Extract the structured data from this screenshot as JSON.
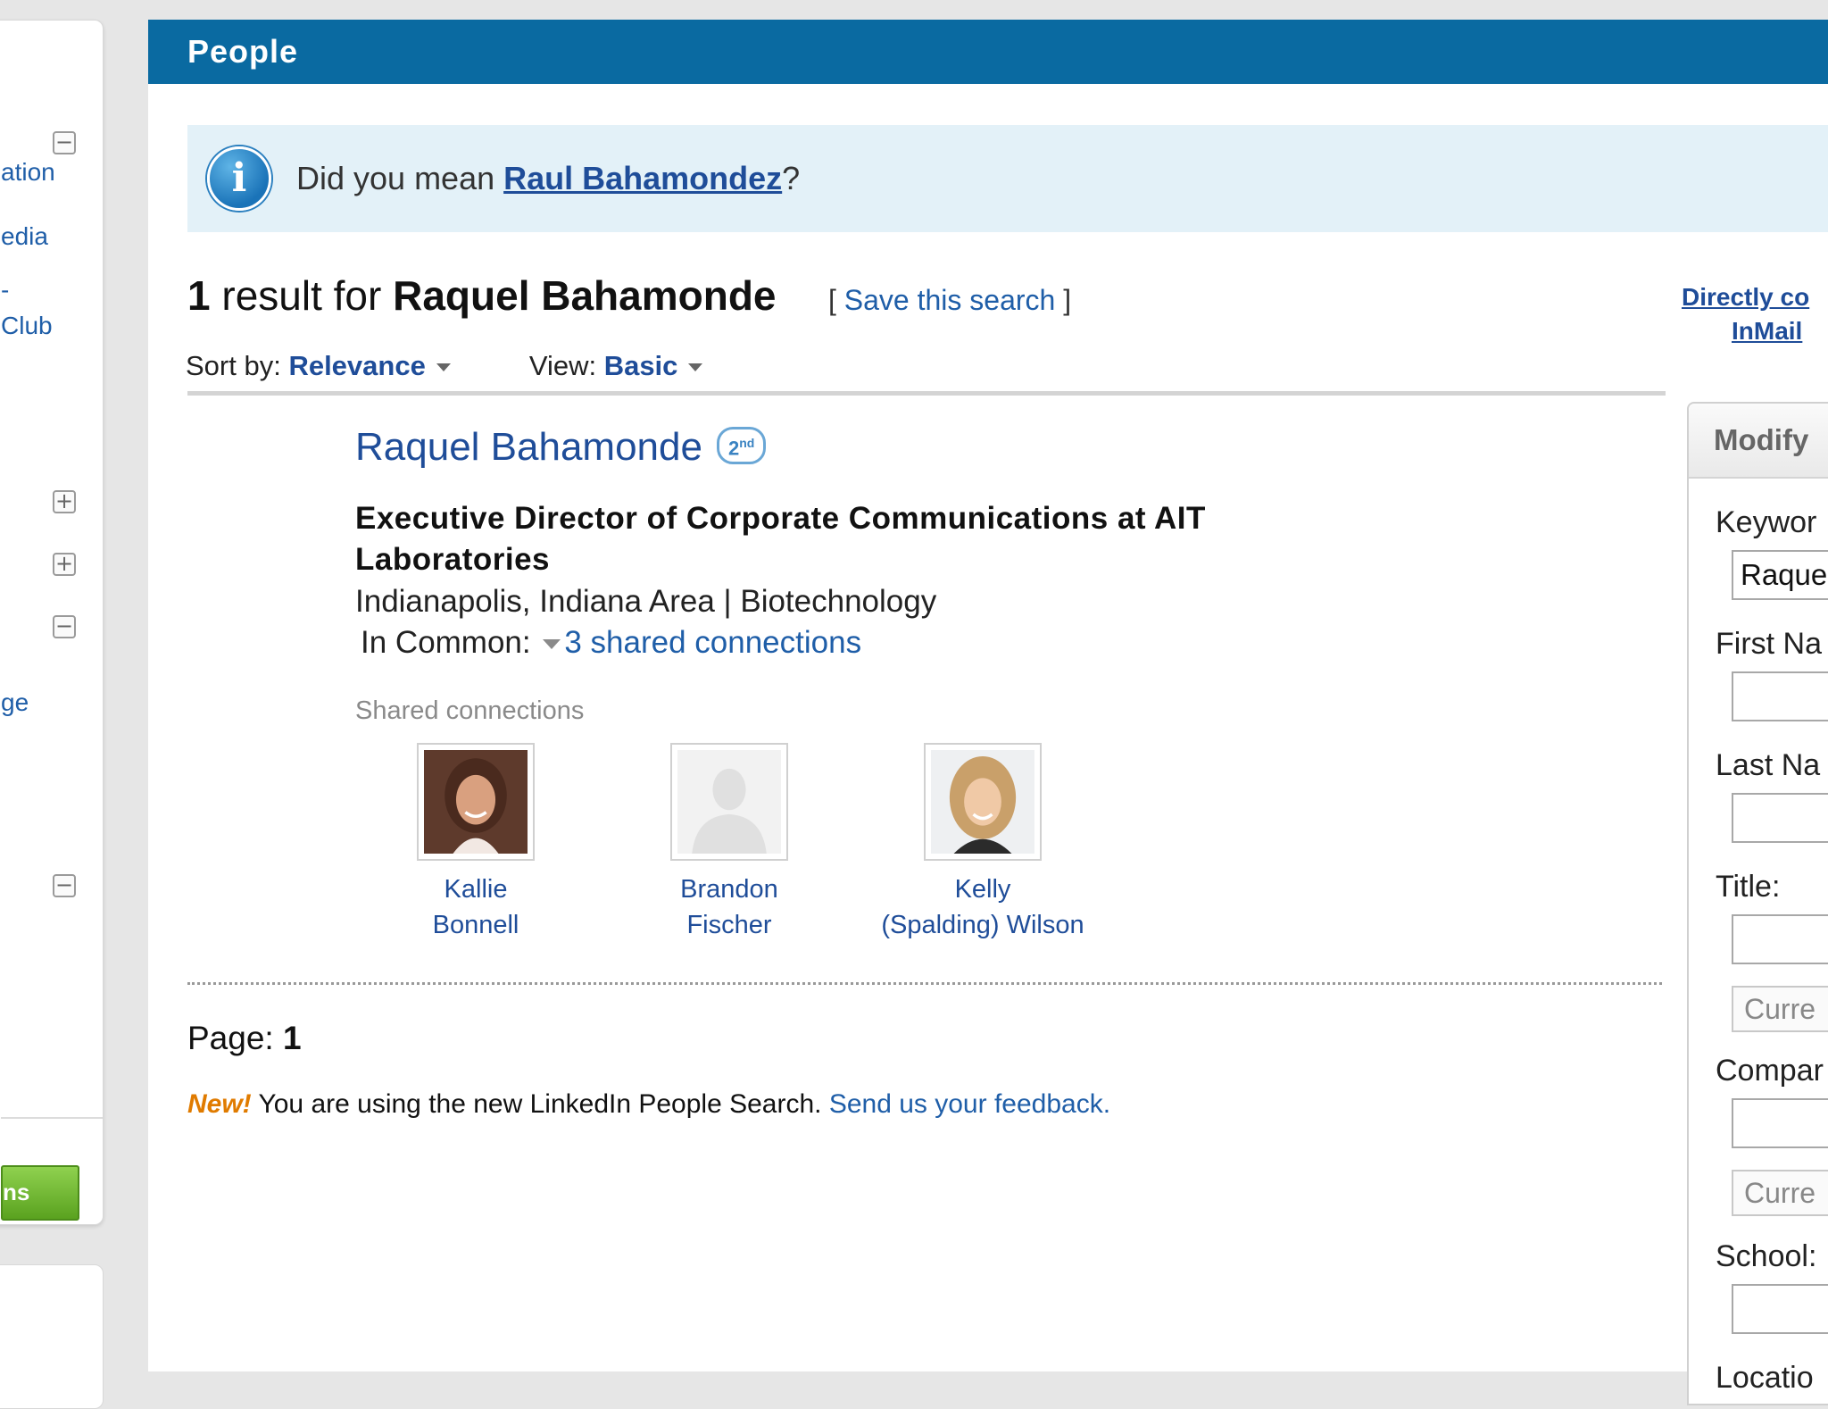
{
  "sidebar": {
    "links": [
      "ation",
      "edia",
      "-",
      "Club",
      "ge"
    ],
    "button_label": "ns"
  },
  "header": {
    "title": "People"
  },
  "did_you_mean": {
    "prefix": "Did you mean ",
    "suggestion": "Raul Bahamondez",
    "suffix": "?"
  },
  "results": {
    "count": "1",
    "label": " result for ",
    "query": "Raquel Bahamonde",
    "save_open": "[ ",
    "save_label": "Save this search",
    "save_close": " ]"
  },
  "sort": {
    "sort_label": "Sort by: ",
    "sort_value": "Relevance",
    "view_label": "View: ",
    "view_value": "Basic"
  },
  "person": {
    "name": "Raquel Bahamonde",
    "degree": "2",
    "degree_suffix": "nd",
    "title": "Executive Director of Corporate Communications at AIT Laboratories",
    "location": "Indianapolis, Indiana Area | Biotechnology",
    "in_common_label": "In Common: ",
    "shared_connections_link": "3 shared connections",
    "shared_label": "Shared connections",
    "connections": [
      {
        "line1": "Kallie",
        "line2": "Bonnell"
      },
      {
        "line1": "Brandon",
        "line2": "Fischer"
      },
      {
        "line1": "Kelly",
        "line2": "(Spalding) Wilson"
      }
    ]
  },
  "pagination": {
    "label": "Page: ",
    "current": "1"
  },
  "feedback": {
    "new_label": "New!",
    "text": " You are using the new LinkedIn People Search. ",
    "link": "Send us your feedback."
  },
  "right": {
    "inmail_line1": "Directly co",
    "inmail_line2": "InMail",
    "modify_title": "Modify",
    "keywords_label": "Keywor",
    "keywords_value": "Raque",
    "first_name_label": "First Na",
    "last_name_label": "Last Na",
    "title_label": "Title:",
    "title_select": "Curre",
    "company_label": "Compar",
    "company_select": "Curre",
    "school_label": "School:",
    "location_label": "Locatio"
  }
}
